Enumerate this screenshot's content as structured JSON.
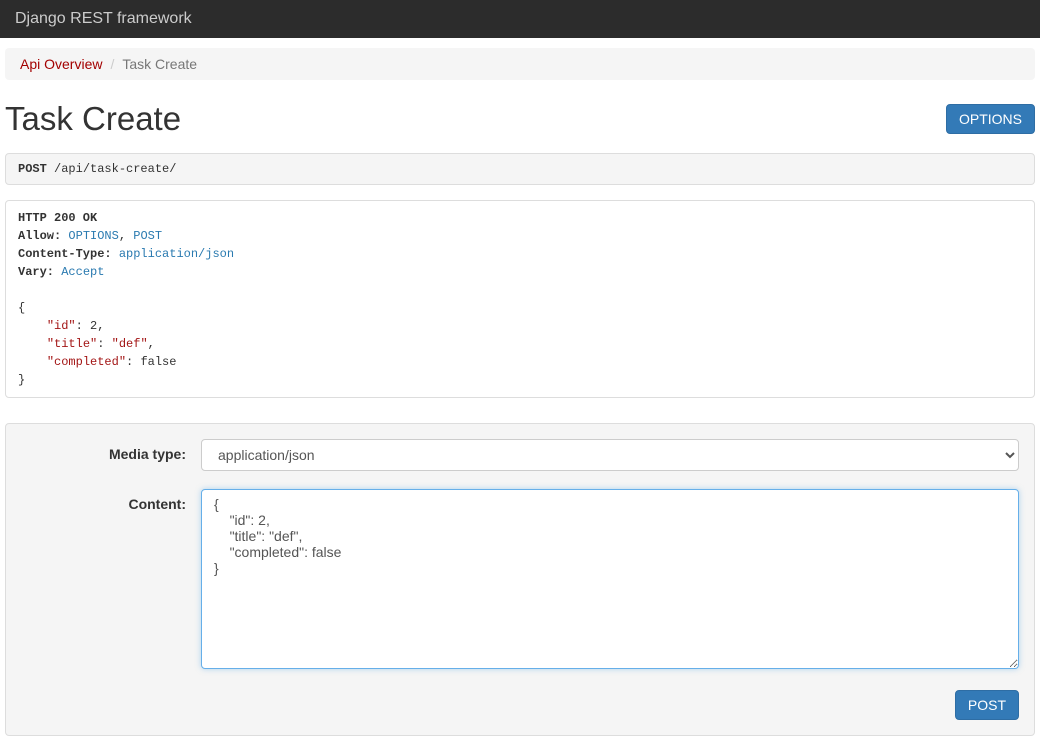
{
  "navbar": {
    "brand": "Django REST framework"
  },
  "breadcrumb": {
    "root": "Api Overview",
    "current": "Task Create",
    "sep": "/"
  },
  "page": {
    "title": "Task Create",
    "options_button": "OPTIONS"
  },
  "request": {
    "method": "POST",
    "path": "/api/task-create/"
  },
  "response": {
    "status_line": "HTTP 200 OK",
    "headers": [
      {
        "name": "Allow",
        "values": [
          "OPTIONS",
          "POST"
        ]
      },
      {
        "name": "Content-Type",
        "values": [
          "application/json"
        ]
      },
      {
        "name": "Vary",
        "values": [
          "Accept"
        ]
      }
    ],
    "body": {
      "id": 2,
      "title": "def",
      "completed": false
    }
  },
  "form": {
    "media_type_label": "Media type:",
    "media_type_value": "application/json",
    "content_label": "Content:",
    "content_value": "{\n    \"id\": 2,\n    \"title\": \"def\",\n    \"completed\": false\n}",
    "submit_label": "POST"
  }
}
